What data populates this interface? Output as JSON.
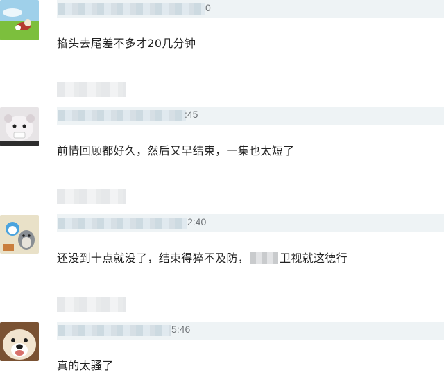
{
  "comments": [
    {
      "meta_time": "0",
      "text": "掐头去尾差不多才20几分钟"
    },
    {
      "meta_time": ":45",
      "text": "前情回顾都好久，然后又早结束，一集也太短了"
    },
    {
      "meta_time": "2:40",
      "text_before": "还没到十点就没了，结束得猝不及防，",
      "text_after": "卫视就这德行"
    },
    {
      "meta_time": "5:46",
      "text": "真的太骚了"
    }
  ]
}
